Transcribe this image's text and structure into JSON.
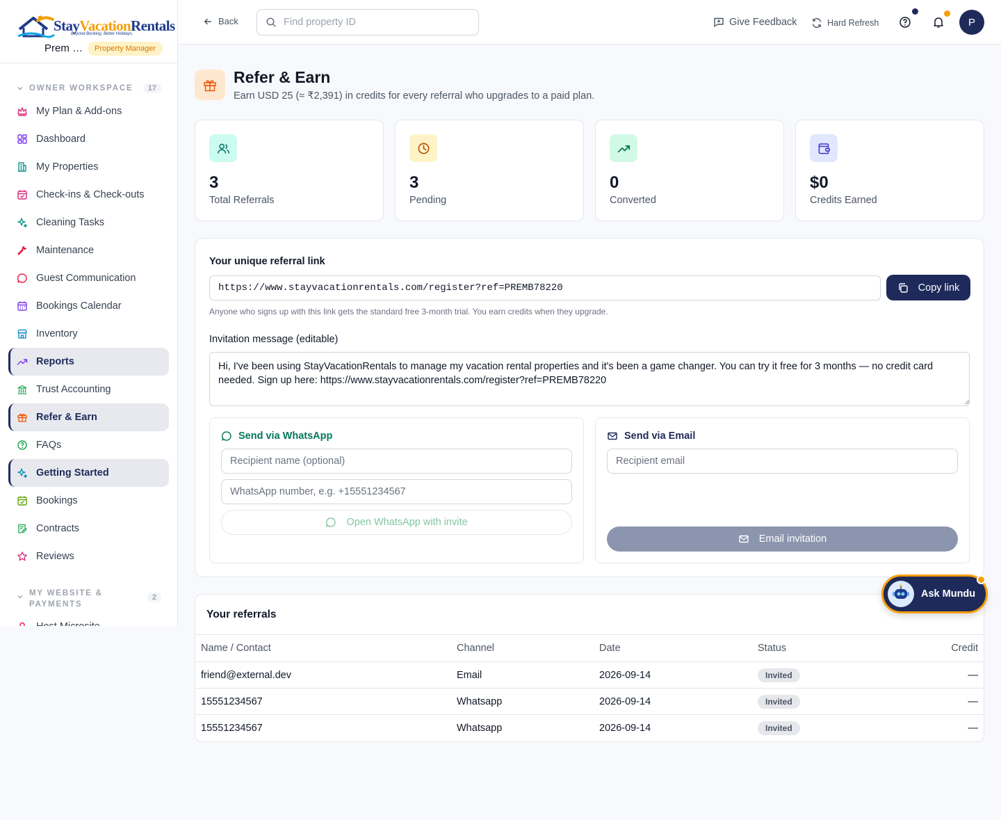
{
  "brand": {
    "name_a": "Stay",
    "name_b": "Vacation",
    "name_c": "Rentals",
    "tagline": "Beyond Booking. Better Holidays."
  },
  "user": {
    "name": "Prem …",
    "role": "Property Manager",
    "avatar_letter": "P"
  },
  "sidebar": {
    "section1": {
      "title": "OWNER WORKSPACE",
      "count": "17"
    },
    "items": [
      {
        "label": "My Plan & Add-ons",
        "icon": "crown-icon",
        "color": "#db2777"
      },
      {
        "label": "Dashboard",
        "icon": "dashboard-icon",
        "color": "#7c3aed"
      },
      {
        "label": "My Properties",
        "icon": "building-icon",
        "color": "#0d9488"
      },
      {
        "label": "Check-ins & Check-outs",
        "icon": "calendar-check-icon",
        "color": "#db2777"
      },
      {
        "label": "Cleaning Tasks",
        "icon": "sparkles-icon",
        "color": "#0d9488"
      },
      {
        "label": "Maintenance",
        "icon": "wrench-icon",
        "color": "#e11d48"
      },
      {
        "label": "Guest Communication",
        "icon": "chat-icon",
        "color": "#e11d48"
      },
      {
        "label": "Bookings Calendar",
        "icon": "calendar-icon",
        "color": "#7c3aed"
      },
      {
        "label": "Inventory",
        "icon": "store-icon",
        "color": "#0284c7"
      },
      {
        "label": "Reports",
        "icon": "trending-up-icon",
        "color": "#7c3aed",
        "active": true
      },
      {
        "label": "Trust Accounting",
        "icon": "bank-icon",
        "color": "#16a34a"
      },
      {
        "label": "Refer & Earn",
        "icon": "gift-icon",
        "color": "#ea580c",
        "active": true
      },
      {
        "label": "FAQs",
        "icon": "help-circle-icon",
        "color": "#16a34a"
      },
      {
        "label": "Getting Started",
        "icon": "sparkles-icon",
        "color": "#0891b2",
        "active": true
      },
      {
        "label": "Bookings",
        "icon": "calendar-check-icon",
        "color": "#65a30d"
      },
      {
        "label": "Contracts",
        "icon": "contract-icon",
        "color": "#16a34a"
      },
      {
        "label": "Reviews",
        "icon": "star-icon",
        "color": "#db2777"
      }
    ],
    "section2": {
      "title": "MY WEBSITE & PAYMENTS",
      "count": "2"
    },
    "items2": [
      {
        "label": "Host Microsite",
        "icon": "user-icon",
        "color": "#e11d48"
      }
    ]
  },
  "topbar": {
    "back": "Back",
    "search_placeholder": "Find property ID",
    "feedback": "Give Feedback",
    "refresh": "Hard Refresh"
  },
  "page": {
    "title": "Refer & Earn",
    "subtitle": "Earn USD 25 (≈ ₹2,391) in credits for every referral who upgrades to a paid plan."
  },
  "stats": [
    {
      "value": "3",
      "label": "Total Referrals",
      "icon": "users-icon",
      "bg": "#ccfbf1",
      "fg": "#0f766e"
    },
    {
      "value": "3",
      "label": "Pending",
      "icon": "clock-icon",
      "bg": "#fef3c7",
      "fg": "#b45309"
    },
    {
      "value": "0",
      "label": "Converted",
      "icon": "trending-up-icon",
      "bg": "#d1fae5",
      "fg": "#047857"
    },
    {
      "value": "$0",
      "label": "Credits Earned",
      "icon": "wallet-icon",
      "bg": "#e0e7ff",
      "fg": "#4338ca"
    }
  ],
  "referral": {
    "heading": "Your unique referral link",
    "link": "https://www.stayvacationrentals.com/register?ref=PREMB78220",
    "copy": "Copy link",
    "hint": "Anyone who signs up with this link gets the standard free 3-month trial. You earn credits when they upgrade.",
    "message_label": "Invitation message (editable)",
    "message": "Hi, I've been using StayVacationRentals to manage my vacation rental properties and it's been a game changer. You can try it free for 3 months — no credit card needed. Sign up here: https://www.stayvacationrentals.com/register?ref=PREMB78220"
  },
  "whatsapp": {
    "title": "Send via WhatsApp",
    "name_ph": "Recipient name (optional)",
    "number_ph": "WhatsApp number, e.g. +15551234567",
    "button": "Open WhatsApp with invite"
  },
  "email": {
    "title": "Send via Email",
    "email_ph": "Recipient email",
    "button": "Email invitation"
  },
  "referrals": {
    "title": "Your referrals",
    "columns": [
      "Name / Contact",
      "Channel",
      "Date",
      "Status",
      "Credit"
    ],
    "rows": [
      [
        "friend@external.dev",
        "Email",
        "2026-09-14",
        "Invited",
        "—"
      ],
      [
        "15551234567",
        "Whatsapp",
        "2026-09-14",
        "Invited",
        "—"
      ],
      [
        "15551234567",
        "Whatsapp",
        "2026-09-14",
        "Invited",
        "—"
      ]
    ]
  },
  "assistant": {
    "label": "Ask Mundu"
  },
  "colors": {
    "primary": "#1e2a5a",
    "accent": "#f59e0b"
  }
}
